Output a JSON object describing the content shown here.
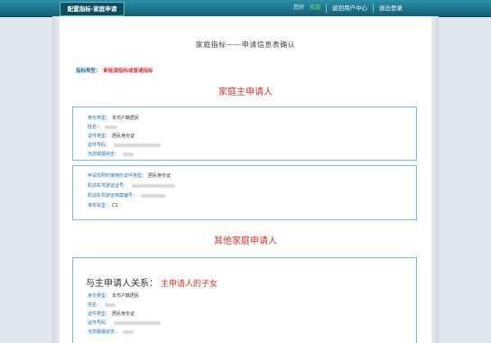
{
  "header": {
    "app_tab": "配置指标-家庭申请",
    "right_text_1": "您好",
    "right_text_2": "欢迎",
    "user_center": "返回用户中心",
    "logout": "退出登录"
  },
  "page": {
    "title": "家庭指标——申请信息表确认",
    "indicator_type_label": "指标类型：",
    "indicator_type_value": "新能源指标或普通指标",
    "main_applicant_heading": "家庭主申请人",
    "other_applicants_heading": "其他家庭申请人"
  },
  "main_applicant": {
    "fields": [
      {
        "label": "身份类型：",
        "value": "本市户籍居民"
      },
      {
        "label": "姓名：",
        "value": ""
      },
      {
        "label": "证件类型：",
        "value": "居民身份证"
      },
      {
        "label": "证件号码：",
        "value": ""
      },
      {
        "label": "当前婚姻状态：",
        "value": ""
      }
    ],
    "license_fields": [
      {
        "label": "申请驾照时使用的证件类型：",
        "value": "居民身份证"
      },
      {
        "label": "机动车驾驶证证号：",
        "value": ""
      },
      {
        "label": "机动车驾驶证档案编号：",
        "value": ""
      },
      {
        "label": "准驾车型：",
        "value": "C1"
      }
    ]
  },
  "other_applicant": {
    "relation_label": "与主申请人关系：",
    "relation_value": "主申请人的子女",
    "fields": [
      {
        "label": "身份类型：",
        "value": "本市户籍居民"
      },
      {
        "label": "姓名：",
        "value": ""
      },
      {
        "label": "证件类型：",
        "value": "居民身份证"
      },
      {
        "label": "证件号码：",
        "value": ""
      },
      {
        "label": "当前婚姻状态：",
        "value": ""
      }
    ]
  },
  "colors": {
    "header_blue": "#0f5f74",
    "label_blue": "#1d6fae",
    "accent_red": "#e0312b",
    "panel_border": "#6ec3d8"
  }
}
